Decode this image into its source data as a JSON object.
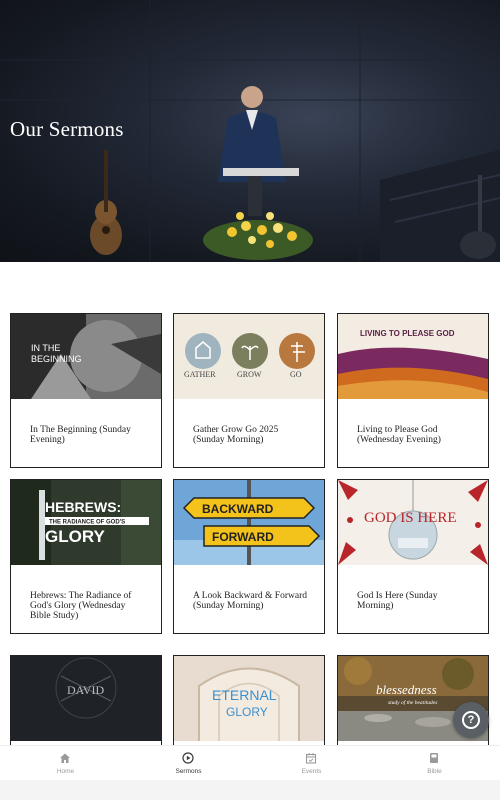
{
  "hero": {
    "title": "Our Sermons"
  },
  "sermons": [
    {
      "title": "In The Beginning (Sunday Evening)",
      "thumb_text": "IN THE BEGINNING"
    },
    {
      "title": "Gather Grow Go 2025 (Sunday Morning)",
      "thumb_labels": [
        "GATHER",
        "GROW",
        "GO"
      ]
    },
    {
      "title": "Living to Please God (Wednesday Evening)",
      "thumb_text": "LIVING TO PLEASE GOD"
    },
    {
      "title": "Hebrews: The Radiance of God's Glory (Wednesday Bible Study)",
      "thumb_text_top": "HEBREWS:",
      "thumb_text_mid": "THE RADIANCE OF GOD'S",
      "thumb_text_bottom": "GLORY"
    },
    {
      "title": "A Look Backward & Forward (Sunday Morning)",
      "thumb_text_top": "BACKWARD",
      "thumb_text_bottom": "FORWARD"
    },
    {
      "title": "God Is Here (Sunday Morning)",
      "thumb_text": "GOD IS HERE"
    },
    {
      "title": "",
      "thumb_text": "DAVID"
    },
    {
      "title": "",
      "thumb_text_top": "ETERNAL",
      "thumb_text_bottom": "GLORY"
    },
    {
      "title": "",
      "thumb_text": "blessedness",
      "thumb_subtext": "study of the beatitudes"
    }
  ],
  "nav": {
    "items": [
      {
        "label": "Home",
        "icon": "home-icon"
      },
      {
        "label": "Sermons",
        "icon": "play-circle-icon"
      },
      {
        "label": "Events",
        "icon": "calendar-icon"
      },
      {
        "label": "Bible",
        "icon": "book-icon"
      }
    ],
    "active": "Sermons"
  },
  "help": {
    "icon": "help-icon",
    "glyph": "?"
  },
  "colors": {
    "hero_dark": "#141820",
    "card_border": "#222222",
    "nav_active": "#3a3a3a",
    "nav_inactive": "#9a9a9a",
    "help_bg": "#5a5f66"
  }
}
